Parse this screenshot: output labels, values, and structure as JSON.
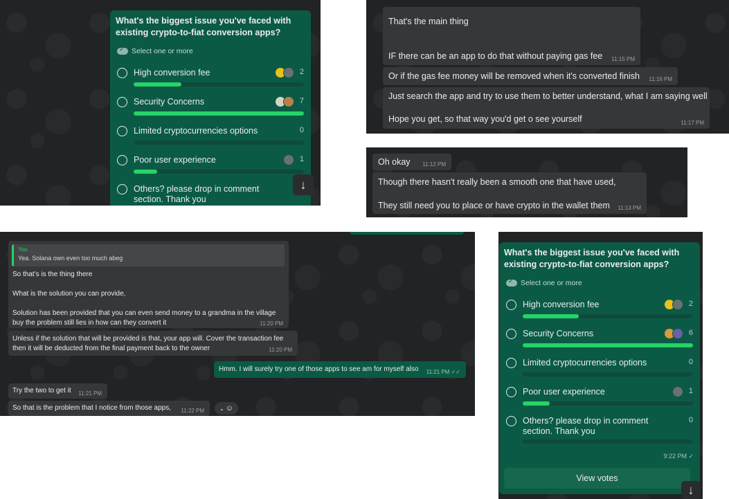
{
  "poll_common": {
    "question": "What's the biggest issue you've faced with existing crypto-to-fiat conversion apps?",
    "select_hint": "Select one or more"
  },
  "poll_a": {
    "options": [
      {
        "label": "High conversion fee",
        "count": "2",
        "fill": 0.28
      },
      {
        "label": "Security Concerns",
        "count": "7",
        "fill": 1.0
      },
      {
        "label": "Limited cryptocurrencies options",
        "count": "0",
        "fill": 0
      },
      {
        "label": "Poor user experience",
        "count": "1",
        "fill": 0.14
      },
      {
        "label": "Others? please drop in comment section. Thank you",
        "count": "",
        "fill": 0
      }
    ]
  },
  "poll_b": {
    "options": [
      {
        "label": "High conversion fee",
        "count": "2",
        "fill": 0.33
      },
      {
        "label": "Security Concerns",
        "count": "6",
        "fill": 1.0
      },
      {
        "label": "Limited cryptocurrencies options",
        "count": "0",
        "fill": 0
      },
      {
        "label": "Poor user experience",
        "count": "1",
        "fill": 0.16
      },
      {
        "label": "Others? please drop in comment section. Thank you",
        "count": "0",
        "fill": 0
      }
    ],
    "time": "9:22 PM ✓",
    "view_votes": "View votes"
  },
  "chat_top_right": [
    {
      "text": "That's the main thing",
      "time": ""
    },
    {
      "text": "IF there can be an app to do that without paying gas fee",
      "time": "11:15 PM"
    },
    {
      "text": "Or if the gas fee money will be removed when it's converted finish",
      "time": "11:16 PM"
    },
    {
      "text": "Just search the app and try to use them to better understand, what I am saying well",
      "time": ""
    },
    {
      "text": "Hope you get, so that way you'd get o see yourself",
      "time": "11:17 PM"
    }
  ],
  "chat_mid_right": [
    {
      "text": "Oh okay",
      "time": "11:12 PM"
    },
    {
      "text": "Though there hasn't really been a smooth one that have used,",
      "time": ""
    },
    {
      "text": "They still need you to place or have crypto in the wallet them",
      "time": "11:13 PM"
    }
  ],
  "chat_bottom_left": {
    "reply_author": "You",
    "reply_text": "Yea. Solana own even too much abeg",
    "lines": [
      "So that's is the thing there",
      "What is the solution you can provide,",
      "Solution has been provided that you can even send money to a grandma in the village",
      "buy the problem still lies in how can they convert it"
    ],
    "time1": "11:20 PM",
    "msg2_line1": "Unless if the solution that will be provided is that, your app will. Cover the transaction fee",
    "msg2_line2": "then it will be deducted from the final payment back to the owner",
    "time2": "11:20 PM",
    "out_text": "Hmm. I will surely try one of those apps to see am for myself also",
    "out_time": "11:21 PM ✓✓",
    "msg3": "Try the two to get it",
    "time3": "11:21 PM",
    "msg4": "So that is the problem that I notice from those apps,",
    "time4": "11:22 PM"
  },
  "colors": {
    "bubble_out": "#0b5a45",
    "bubble_in": "#363738",
    "accent": "#25d366",
    "bg": "#222324"
  }
}
